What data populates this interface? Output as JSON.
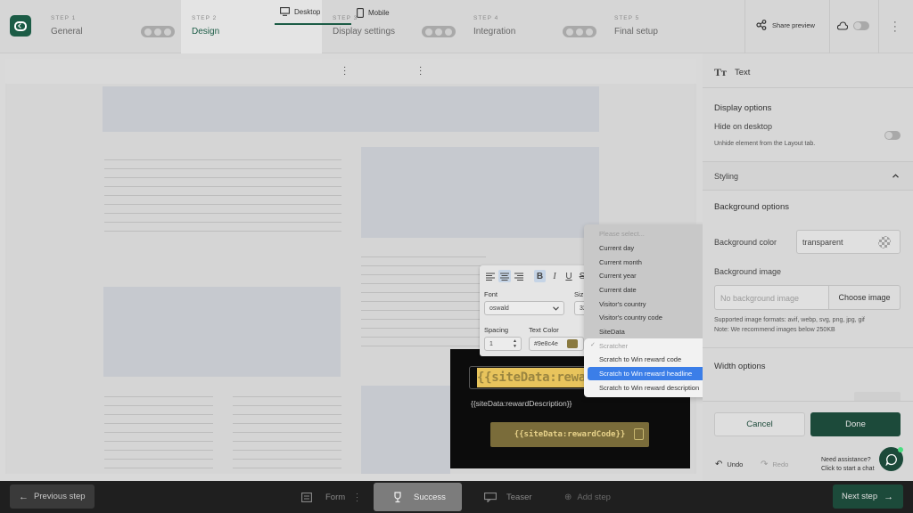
{
  "steps": [
    {
      "num": "STEP 1",
      "name": "General"
    },
    {
      "num": "STEP 2",
      "name": "Design"
    },
    {
      "num": "STEP 3",
      "name": "Display settings"
    },
    {
      "num": "STEP 4",
      "name": "Integration"
    },
    {
      "num": "STEP 5",
      "name": "Final setup"
    }
  ],
  "header": {
    "share_label": "Share preview"
  },
  "canvas_tabs": {
    "desktop": "Desktop",
    "mobile": "Mobile"
  },
  "preview": {
    "headline": "{{siteData:rewardHeadline}}",
    "description": "{{siteData:rewardDescription}}",
    "code": "{{siteData:rewardCode}}"
  },
  "toolbar": {
    "font_label": "Font",
    "font_value": "oswald",
    "size_label": "Siz",
    "size_value": "32",
    "spacing_label": "Spacing",
    "spacing_value": "1",
    "color_label": "Text Color",
    "color_value": "#9e8c4e"
  },
  "dropdown": {
    "placeholder": "Please select...",
    "items": [
      "Current day",
      "Current month",
      "Current year",
      "Current date",
      "Visitor's country",
      "Visitor's country code",
      "SiteData"
    ],
    "group_label": "Scratcher",
    "group_items": [
      "Scratch to Win reward code",
      "Scratch to Win reward headline",
      "Scratch to Win reward description"
    ],
    "highlighted": "Scratch to Win reward headline"
  },
  "panel": {
    "title": "Text",
    "display_options": "Display options",
    "hide_desktop": "Hide on desktop",
    "hide_desktop_hint": "Unhide element from the Layout tab.",
    "styling": "Styling",
    "bg_options": "Background options",
    "bg_color_label": "Background color",
    "bg_color_value": "transparent",
    "bg_image_label": "Background image",
    "bg_image_placeholder": "No background image",
    "choose_image": "Choose image",
    "formats_note": "Supported image formats: avif, webp, svg, png, jpg, gif",
    "size_note": "Note: We recommend images below 250KB",
    "width_options": "Width options",
    "cancel": "Cancel",
    "done": "Done",
    "undo": "Undo",
    "redo": "Redo",
    "assist_title": "Need assistance?",
    "assist_sub": "Click to start a chat"
  },
  "bottom": {
    "prev": "Previous step",
    "next": "Next step",
    "tabs": [
      "Form",
      "Success",
      "Teaser",
      "Add step"
    ]
  },
  "colors": {
    "brand": "#1c4a3a",
    "highlight": "#3b7ee8",
    "text_swatch": "#9e8c4e"
  }
}
